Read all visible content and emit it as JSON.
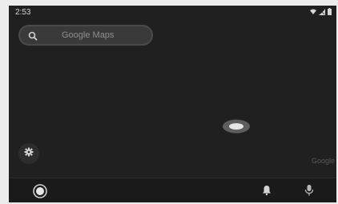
{
  "status": {
    "time": "2:53",
    "icons": [
      "wifi-icon",
      "signal-icon",
      "battery-icon"
    ]
  },
  "search": {
    "placeholder": "Google Maps",
    "icon": "search-icon"
  },
  "map": {
    "watermark": "Google",
    "marker": "location-marker"
  },
  "controls": {
    "settings_icon": "gear-icon"
  },
  "nav": {
    "items": [
      "home-icon",
      "bell-icon",
      "mic-icon"
    ]
  },
  "colors": {
    "screen_background": "#202020",
    "search_background": "#3a3a3a",
    "nav_background": "#1a1a1a",
    "marker_fill": "#e0e0e0",
    "marker_outer": "#666666"
  }
}
